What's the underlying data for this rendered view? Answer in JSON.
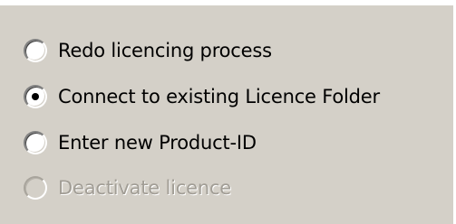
{
  "options": [
    {
      "label": "Redo licencing process",
      "checked": false,
      "disabled": false
    },
    {
      "label": "Connect to existing Licence Folder",
      "checked": true,
      "disabled": false
    },
    {
      "label": "Enter new Product-ID",
      "checked": false,
      "disabled": false
    },
    {
      "label": "Deactivate licence",
      "checked": false,
      "disabled": true
    }
  ],
  "colors": {
    "panel_bg": "#d4d0c8",
    "text": "#000000",
    "disabled_text": "#a19d95"
  }
}
